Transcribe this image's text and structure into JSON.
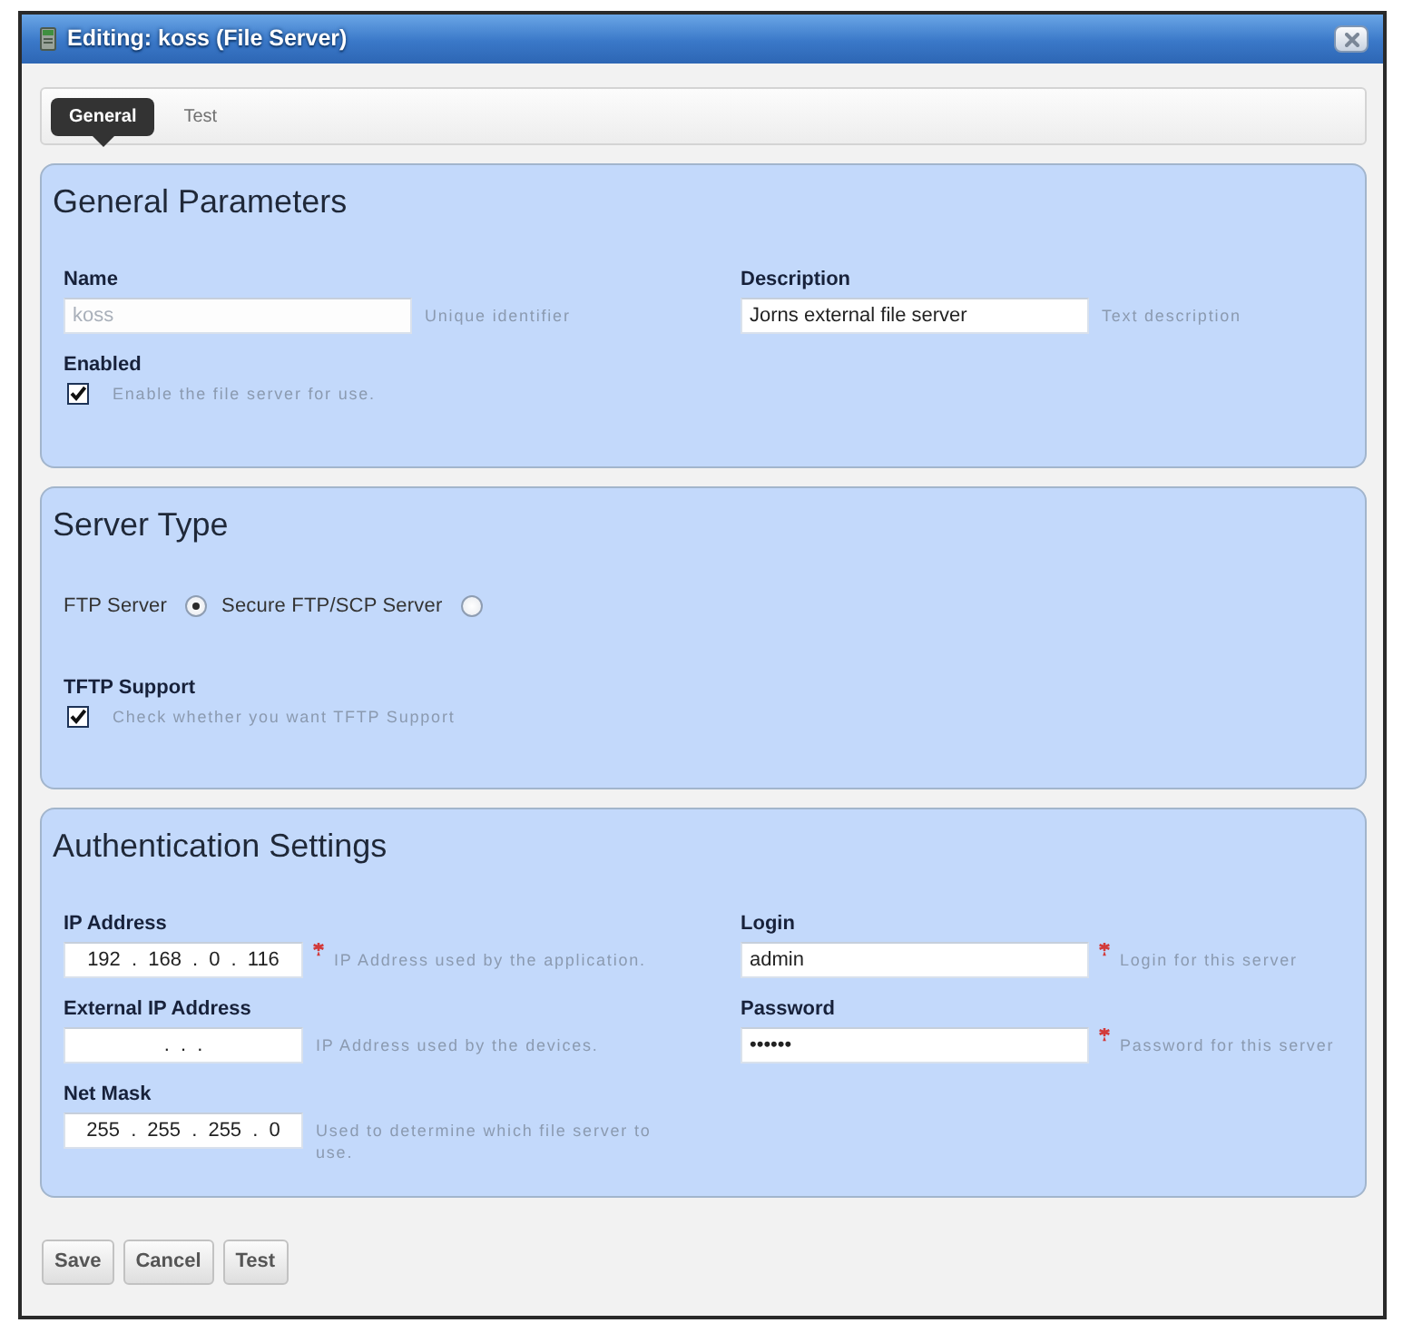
{
  "window": {
    "title": "Editing: koss (File Server)"
  },
  "tabs": [
    {
      "label": "General",
      "selected": true
    },
    {
      "label": "Test",
      "selected": false
    }
  ],
  "sections": [
    {
      "title": "General Parameters",
      "left": [
        {
          "kind": "text",
          "label": "Name",
          "value": "koss",
          "disabled": true,
          "required": false,
          "hint": "Unique identifier"
        },
        {
          "kind": "checkbox",
          "label": "Enabled",
          "checked": true,
          "hint": "Enable the file server for use."
        }
      ],
      "right": [
        {
          "kind": "text",
          "label": "Description",
          "value": "Jorns external file server",
          "disabled": false,
          "required": false,
          "hint": "Text description"
        }
      ]
    },
    {
      "title": "Server Type",
      "left": [
        {
          "kind": "radio",
          "options": [
            {
              "label": "FTP Server",
              "selected": true
            },
            {
              "label": "Secure FTP/SCP Server",
              "selected": false
            }
          ]
        },
        {
          "kind": "checkbox",
          "label": "TFTP Support",
          "checked": true,
          "hint": "Check whether you want TFTP Support"
        }
      ]
    },
    {
      "title": "Authentication Settings",
      "left": [
        {
          "kind": "ip",
          "label": "IP Address",
          "value": "192 . 168 . 0 . 116",
          "required": true,
          "hint": "IP Address used by the application."
        },
        {
          "kind": "ip",
          "label": "External IP Address",
          "value": ". . .",
          "required": false,
          "hint": "IP Address used by the devices."
        },
        {
          "kind": "ip",
          "label": "Net Mask",
          "value": "255 . 255 . 255 . 0",
          "required": false,
          "hint": "Used to determine which file server to use."
        }
      ],
      "right": [
        {
          "kind": "text",
          "label": "Login",
          "value": "admin",
          "disabled": false,
          "required": true,
          "hint": "Login for this server"
        },
        {
          "kind": "text",
          "label": "Password",
          "value": "••••••",
          "disabled": false,
          "required": true,
          "hint": "Password for this server"
        }
      ]
    }
  ],
  "buttons": [
    "Save",
    "Cancel",
    "Test"
  ]
}
